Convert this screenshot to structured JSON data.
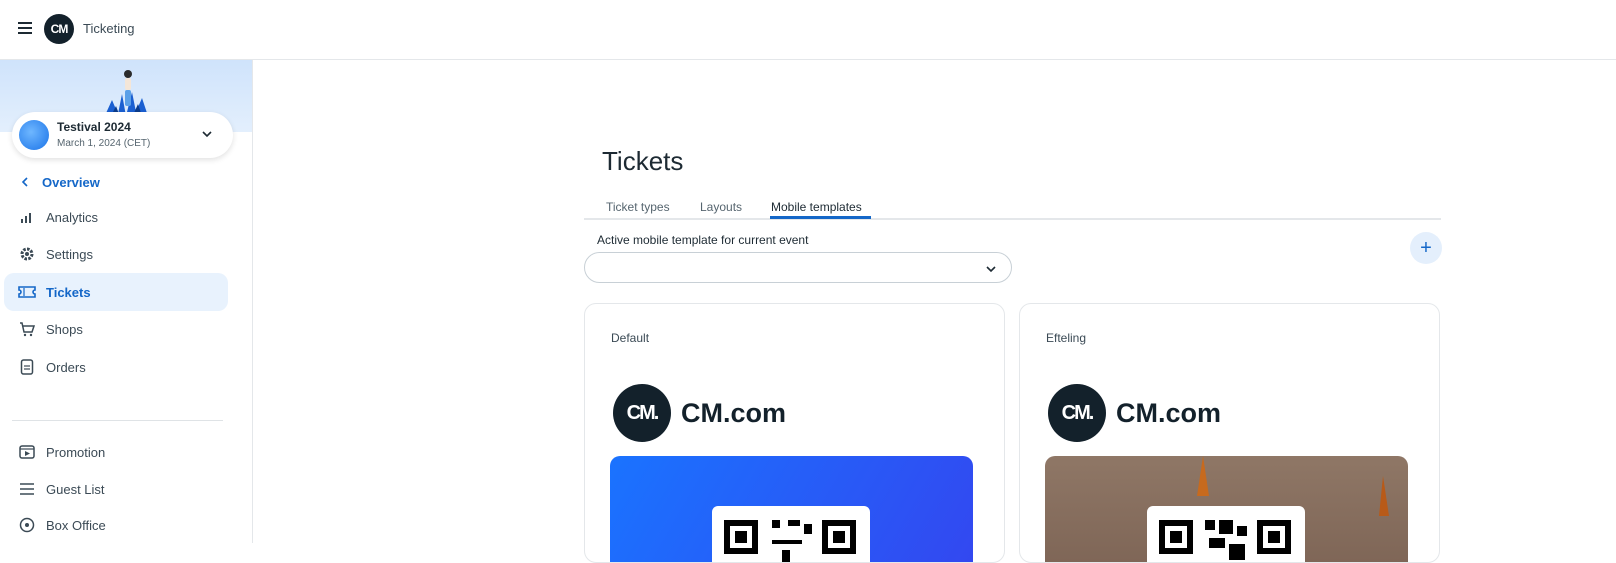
{
  "app": {
    "name": "Ticketing",
    "logo_text": "CM"
  },
  "event": {
    "name": "Testival 2024",
    "date": "March 1, 2024 (CET)"
  },
  "sidebar": {
    "back_label": "Overview",
    "items": [
      {
        "label": "Analytics",
        "icon": "bar-chart-icon"
      },
      {
        "label": "Settings",
        "icon": "gear-icon"
      },
      {
        "label": "Tickets",
        "icon": "ticket-icon",
        "active": true
      },
      {
        "label": "Shops",
        "icon": "cart-icon"
      },
      {
        "label": "Orders",
        "icon": "document-icon"
      },
      {
        "label": "Promotion",
        "icon": "promotion-icon"
      },
      {
        "label": "Guest List",
        "icon": "list-icon"
      },
      {
        "label": "Box Office",
        "icon": "box-office-icon"
      }
    ]
  },
  "main": {
    "title": "Tickets",
    "tabs": [
      {
        "label": "Ticket types"
      },
      {
        "label": "Layouts"
      },
      {
        "label": "Mobile templates",
        "active": true
      }
    ],
    "select": {
      "label": "Active mobile template for current event",
      "value": ""
    },
    "add_label": "+",
    "templates": [
      {
        "name": "Default",
        "brand": "CM.com",
        "logo_text": "CM."
      },
      {
        "name": "Efteling",
        "brand": "CM.com",
        "logo_text": "CM."
      }
    ]
  },
  "colors": {
    "accent": "#1467c8",
    "active_bg": "#e8f2fd",
    "brand_dark": "#13212b"
  }
}
